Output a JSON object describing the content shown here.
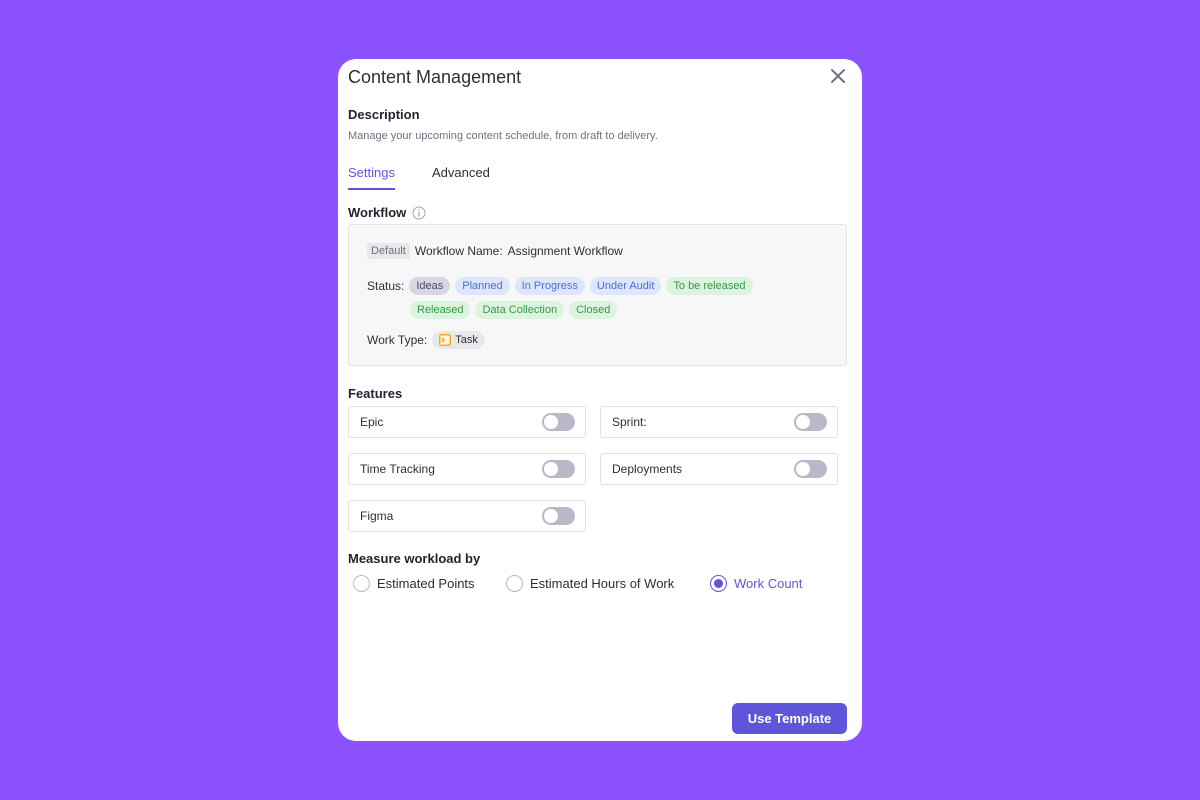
{
  "modal": {
    "title": "Content Management",
    "description_heading": "Description",
    "description_text": "Manage your upcoming content schedule, from draft to delivery."
  },
  "tabs": [
    {
      "label": "Settings",
      "active": true
    },
    {
      "label": "Advanced",
      "active": false
    }
  ],
  "workflow": {
    "heading": "Workflow",
    "info_icon": "info-icon",
    "default_badge": "Default",
    "name_label": "Workflow Name:",
    "name_value": "Assignment Workflow",
    "status_label": "Status:",
    "statuses": [
      {
        "label": "Ideas",
        "color": "#d8d6e4"
      },
      {
        "label": "Planned",
        "color": "#dde6fb"
      },
      {
        "label": "In Progress",
        "color": "#dde6fb"
      },
      {
        "label": "Under Audit",
        "color": "#dde6fb"
      },
      {
        "label": "To be released",
        "color": "#dcf3de"
      },
      {
        "label": "Released",
        "color": "#dcf3de"
      },
      {
        "label": "Data Collection",
        "color": "#dcf3de"
      },
      {
        "label": "Closed",
        "color": "#dcf3de"
      }
    ],
    "work_type_label": "Work Type:",
    "work_type_value": "Task",
    "work_type_icon": "task-icon"
  },
  "features": {
    "heading": "Features",
    "items": [
      {
        "label": "Epic",
        "enabled": false
      },
      {
        "label": "Sprint:",
        "enabled": false
      },
      {
        "label": "Time Tracking",
        "enabled": false
      },
      {
        "label": "Deployments",
        "enabled": false
      },
      {
        "label": "Figma",
        "enabled": false
      }
    ]
  },
  "measure": {
    "heading": "Measure workload by",
    "options": [
      {
        "label": "Estimated Points",
        "selected": false
      },
      {
        "label": "Estimated Hours of Work",
        "selected": false
      },
      {
        "label": "Work Count",
        "selected": true
      }
    ]
  },
  "footer": {
    "use_template_label": "Use Template"
  },
  "colors": {
    "background": "#8c52ff",
    "accent": "#5f55d9",
    "toggle_off": "#b9b8c9"
  }
}
